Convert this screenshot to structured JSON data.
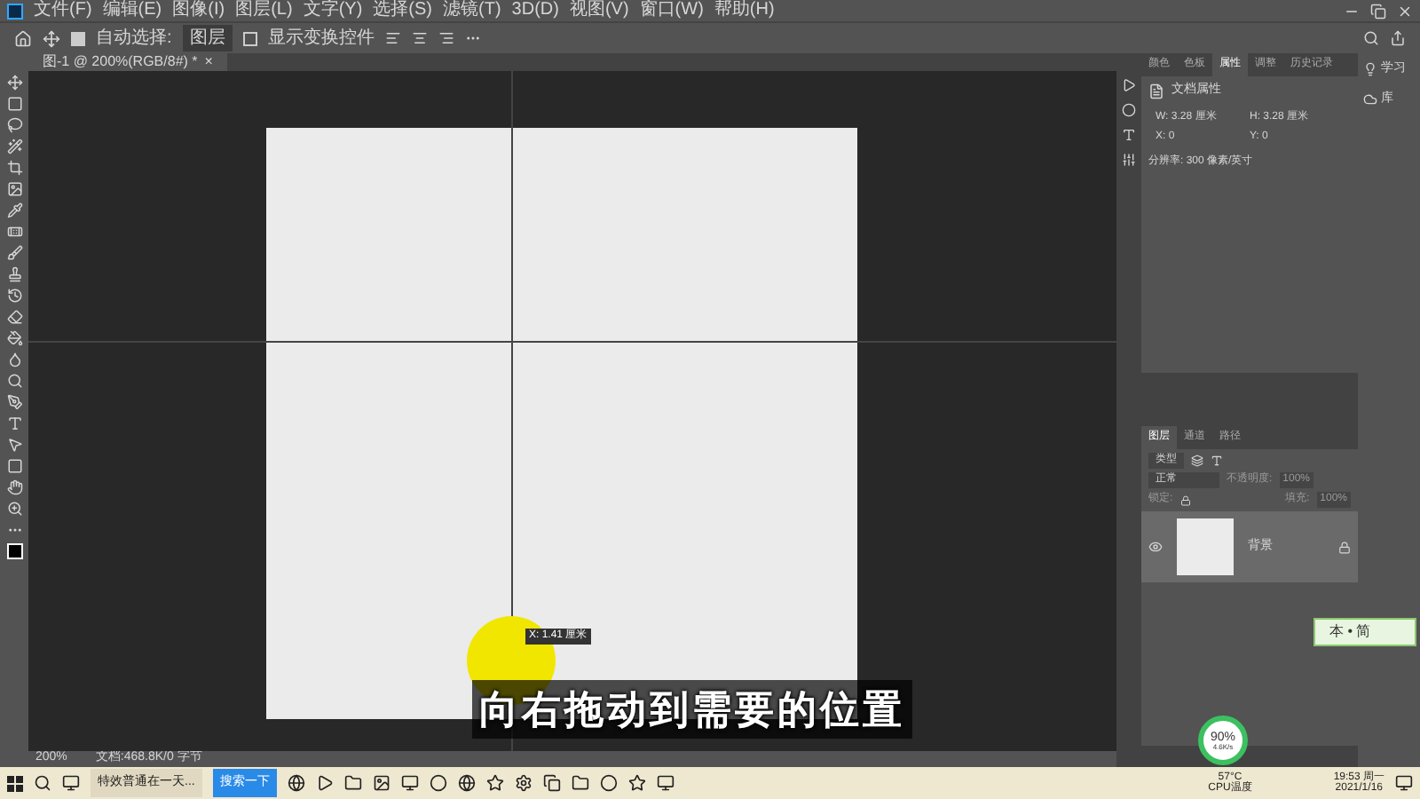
{
  "menu": [
    "文件(F)",
    "编辑(E)",
    "图像(I)",
    "图层(L)",
    "文字(Y)",
    "选择(S)",
    "滤镜(T)",
    "3D(D)",
    "视图(V)",
    "窗口(W)",
    "帮助(H)"
  ],
  "options": {
    "auto_select_label": "自动选择:",
    "auto_select_checked": true,
    "target": "图层",
    "show_transform_label": "显示变换控件",
    "show_transform_checked": false
  },
  "doc_tab": {
    "title": "图-1 @ 200%(RGB/8#) *",
    "close": "×"
  },
  "canvas": {
    "tooltip": "X: 1.41 厘米",
    "subtitle": "向右拖动到需要的位置"
  },
  "properties": {
    "tabs": [
      {
        "label": "颜色",
        "selected": false
      },
      {
        "label": "色板",
        "selected": false
      },
      {
        "label": "属性",
        "selected": true
      },
      {
        "label": "调整",
        "selected": false
      },
      {
        "label": "历史记录",
        "selected": false
      }
    ],
    "section_title": "文档属性",
    "fields": [
      {
        "label": "W:",
        "value": "3.28 厘米"
      },
      {
        "label": "H:",
        "value": "3.28 厘米"
      },
      {
        "label": "X:",
        "value": "0"
      },
      {
        "label": "Y:",
        "value": "0"
      }
    ],
    "resolution": "分辨率: 300 像素/英寸"
  },
  "side_strip": [
    {
      "kind": "learn",
      "label": "学习"
    },
    {
      "kind": "library",
      "label": "库"
    }
  ],
  "layers": {
    "tabs": [
      {
        "label": "图层",
        "selected": true
      },
      {
        "label": "通道",
        "selected": false
      },
      {
        "label": "路径",
        "selected": false
      }
    ],
    "filter_kind": "类型",
    "blend": "正常",
    "opacity_label": "不透明度:",
    "opacity": "100%",
    "lock_label": "锁定:",
    "fill_label": "填充:",
    "fill": "100%",
    "items": [
      {
        "name": "背景",
        "visible": true,
        "locked": true
      }
    ]
  },
  "status": {
    "zoom": "200%",
    "doc": "文档:468.8K/0 字节"
  },
  "ime": {
    "text": "本 • 简"
  },
  "net_widget": {
    "percent": "90%",
    "speed": "4.6K/s"
  },
  "taskbar": {
    "windows": [
      {
        "label": "特效普通在一天...",
        "selected": false
      },
      {
        "label": "搜索一下",
        "selected": true
      }
    ],
    "temp": "57°C",
    "temp_label": "CPU温度",
    "time": "19:53 周一",
    "date": "2021/1/16"
  }
}
